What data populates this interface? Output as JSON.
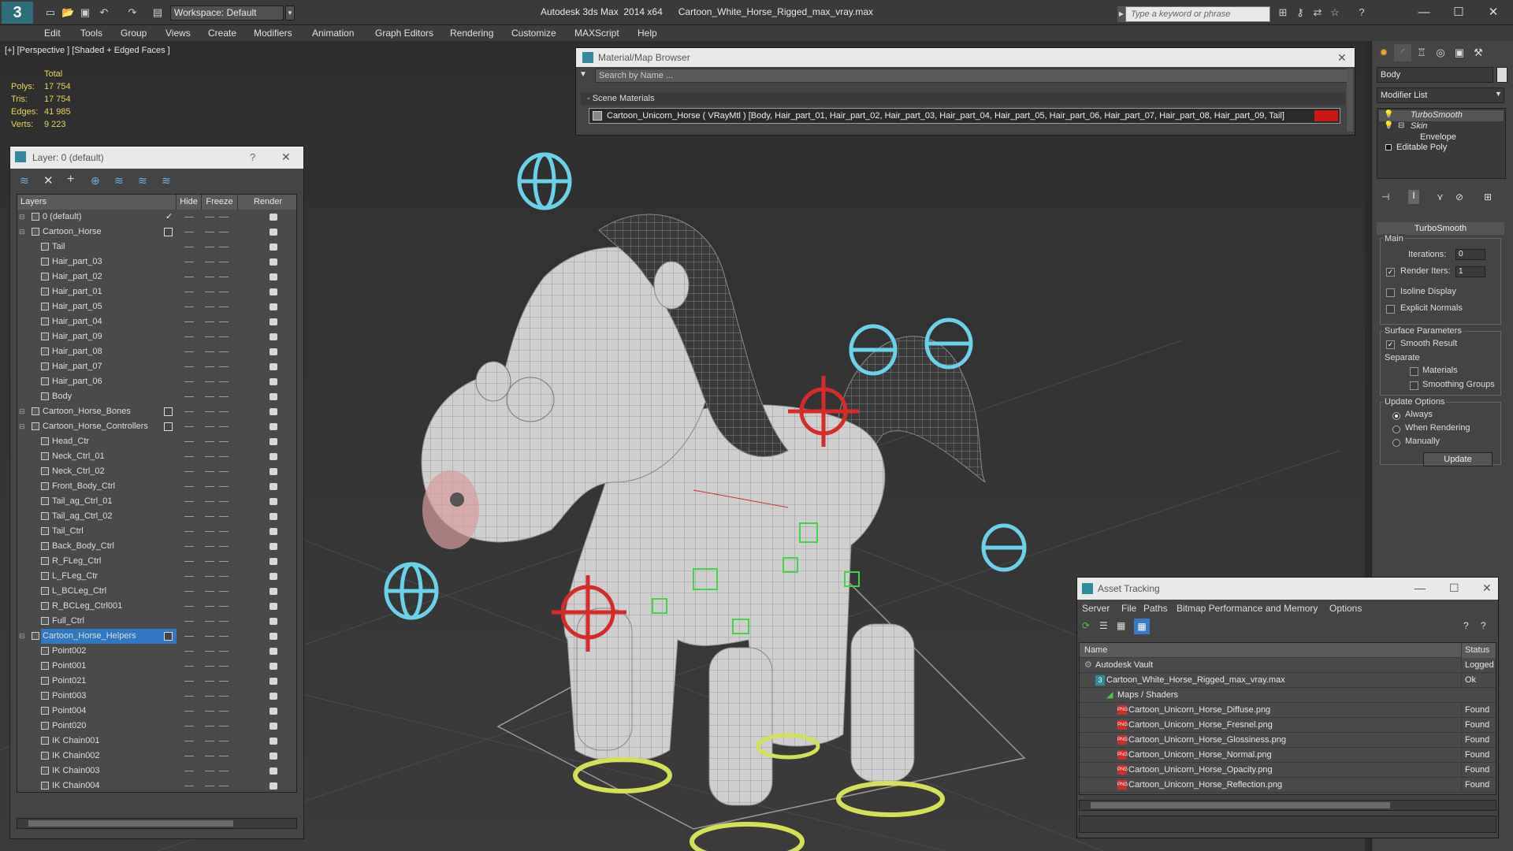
{
  "titlebar": {
    "app_title": "Autodesk 3ds Max  2014 x64      Cartoon_White_Horse_Rigged_max_vray.max",
    "workspace": "Workspace: Default",
    "search_placeholder": "Type a keyword or phrase"
  },
  "menu": [
    "Edit",
    "Tools",
    "Group",
    "Views",
    "Create",
    "Modifiers",
    "Animation",
    "Graph Editors",
    "Rendering",
    "Customize",
    "MAXScript",
    "Help"
  ],
  "viewport": {
    "label": "[+] [Perspective ] [Shaded + Edged Faces ]",
    "stats_title": "Total",
    "stats": [
      {
        "label": "Polys:",
        "value": "17 754"
      },
      {
        "label": "Tris:",
        "value": "17 754"
      },
      {
        "label": "Edges:",
        "value": "41 985"
      },
      {
        "label": "Verts:",
        "value": "9 223"
      }
    ]
  },
  "layer_panel": {
    "title": "Layer: 0 (default)",
    "help": "?",
    "columns": [
      "Layers",
      "Hide",
      "Freeze",
      "Render"
    ],
    "rows": [
      {
        "name": "0 (default)",
        "level": 1,
        "checked": true
      },
      {
        "name": "Cartoon_Horse",
        "level": 1,
        "box": true
      },
      {
        "name": "Tail",
        "level": 2
      },
      {
        "name": "Hair_part_03",
        "level": 2
      },
      {
        "name": "Hair_part_02",
        "level": 2
      },
      {
        "name": "Hair_part_01",
        "level": 2
      },
      {
        "name": "Hair_part_05",
        "level": 2
      },
      {
        "name": "Hair_part_04",
        "level": 2
      },
      {
        "name": "Hair_part_09",
        "level": 2
      },
      {
        "name": "Hair_part_08",
        "level": 2
      },
      {
        "name": "Hair_part_07",
        "level": 2
      },
      {
        "name": "Hair_part_06",
        "level": 2
      },
      {
        "name": "Body",
        "level": 2
      },
      {
        "name": "Cartoon_Horse_Bones",
        "level": 1,
        "box": true
      },
      {
        "name": "Cartoon_Horse_Controllers",
        "level": 1,
        "box": true
      },
      {
        "name": "Head_Ctr",
        "level": 2
      },
      {
        "name": "Neck_Ctrl_01",
        "level": 2
      },
      {
        "name": "Neck_Ctrl_02",
        "level": 2
      },
      {
        "name": "Front_Body_Ctrl",
        "level": 2
      },
      {
        "name": "Tail_ag_Ctrl_01",
        "level": 2
      },
      {
        "name": "Tail_ag_Ctrl_02",
        "level": 2
      },
      {
        "name": "Tail_Ctrl",
        "level": 2
      },
      {
        "name": "Back_Body_Ctrl",
        "level": 2
      },
      {
        "name": "R_FLeg_Ctrl",
        "level": 2
      },
      {
        "name": "L_FLeg_Ctr",
        "level": 2
      },
      {
        "name": "L_BCLeg_Ctrl",
        "level": 2
      },
      {
        "name": "R_BCLeg_Ctrl001",
        "level": 2
      },
      {
        "name": "Full_Ctrl",
        "level": 2
      },
      {
        "name": "Cartoon_Horse_Helpers",
        "level": 1,
        "box": true,
        "selected": true
      },
      {
        "name": "Point002",
        "level": 2
      },
      {
        "name": "Point001",
        "level": 2
      },
      {
        "name": "Point021",
        "level": 2
      },
      {
        "name": "Point003",
        "level": 2
      },
      {
        "name": "Point004",
        "level": 2
      },
      {
        "name": "Point020",
        "level": 2
      },
      {
        "name": "IK Chain001",
        "level": 2
      },
      {
        "name": "IK Chain002",
        "level": 2
      },
      {
        "name": "IK Chain003",
        "level": 2
      },
      {
        "name": "IK Chain004",
        "level": 2
      }
    ]
  },
  "material_browser": {
    "title": "Material/Map Browser",
    "search_placeholder": "Search by Name ...",
    "section": "- Scene Materials",
    "material": "Cartoon_Unicorn_Horse  ( VRayMtl )  [Body, Hair_part_01, Hair_part_02, Hair_part_03, Hair_part_04, Hair_part_05, Hair_part_06, Hair_part_07, Hair_part_08, Hair_part_09, Tail]",
    "swatch_color": "#c81818"
  },
  "command_panel": {
    "object_name": "Body",
    "modifier_list": "Modifier List",
    "stack": [
      "TurboSmooth",
      "Skin",
      "Envelope",
      "Editable Poly"
    ],
    "rollout": "TurboSmooth",
    "main_label": "Main",
    "iterations_label": "Iterations:",
    "iterations_value": "0",
    "render_iters_label": "Render Iters:",
    "render_iters_value": "1",
    "isoline": "Isoline Display",
    "explicit_normals": "Explicit Normals",
    "surface_params": "Surface Parameters",
    "smooth_result": "Smooth Result",
    "separate": "Separate",
    "materials": "Materials",
    "smoothing_groups": "Smoothing Groups",
    "update_options": "Update Options",
    "always": "Always",
    "when_rendering": "When Rendering",
    "manually": "Manually",
    "update_button": "Update"
  },
  "asset_tracking": {
    "title": "Asset Tracking",
    "menu": [
      "Server",
      "File",
      "Paths",
      "Bitmap Performance and Memory",
      "Options"
    ],
    "columns": [
      "Name",
      "Status"
    ],
    "rows": [
      {
        "name": "Autodesk Vault",
        "status": "Logged O",
        "indent": 1
      },
      {
        "name": "Cartoon_White_Horse_Rigged_max_vray.max",
        "status": "Ok",
        "indent": 2
      },
      {
        "name": "Maps / Shaders",
        "status": "",
        "indent": 3
      },
      {
        "name": "Cartoon_Unicorn_Horse_Diffuse.png",
        "status": "Found",
        "indent": 4,
        "png": true
      },
      {
        "name": "Cartoon_Unicorn_Horse_Fresnel.png",
        "status": "Found",
        "indent": 4,
        "png": true
      },
      {
        "name": "Cartoon_Unicorn_Horse_Glossiness.png",
        "status": "Found",
        "indent": 4,
        "png": true
      },
      {
        "name": "Cartoon_Unicorn_Horse_Normal.png",
        "status": "Found",
        "indent": 4,
        "png": true
      },
      {
        "name": "Cartoon_Unicorn_Horse_Opacity.png",
        "status": "Found",
        "indent": 4,
        "png": true
      },
      {
        "name": "Cartoon_Unicorn_Horse_Reflection.png",
        "status": "Found",
        "indent": 4,
        "png": true
      }
    ]
  }
}
